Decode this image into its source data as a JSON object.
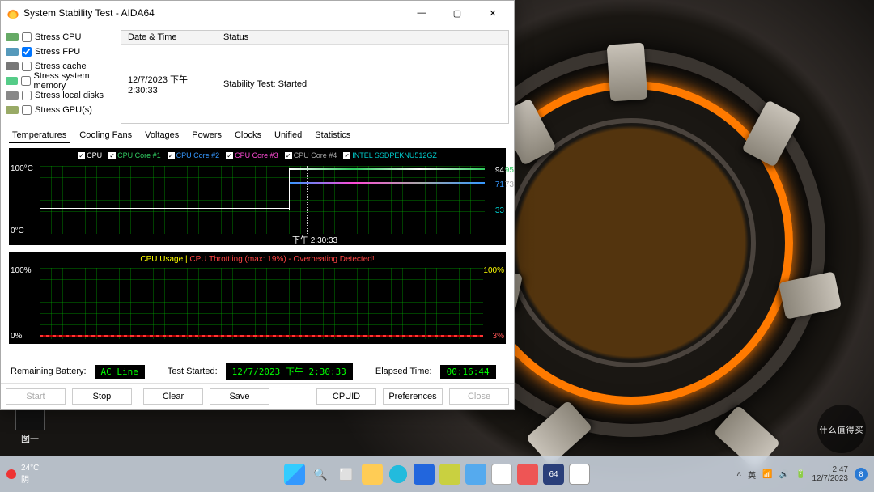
{
  "window": {
    "title": "System Stability Test - AIDA64",
    "buttons": {
      "min": "—",
      "max": "▢",
      "close": "✕"
    }
  },
  "stress": {
    "items": [
      {
        "label": "Stress CPU",
        "checked": false,
        "iconcls": "cpu"
      },
      {
        "label": "Stress FPU",
        "checked": true,
        "iconcls": "fpu"
      },
      {
        "label": "Stress cache",
        "checked": false,
        "iconcls": "cache"
      },
      {
        "label": "Stress system memory",
        "checked": false,
        "iconcls": "mem"
      },
      {
        "label": "Stress local disks",
        "checked": false,
        "iconcls": "disk"
      },
      {
        "label": "Stress GPU(s)",
        "checked": false,
        "iconcls": "gpu"
      }
    ]
  },
  "log": {
    "headers": {
      "c1": "Date & Time",
      "c2": "Status"
    },
    "row": {
      "c1": "12/7/2023 下午 2:30:33",
      "c2": "Stability Test: Started"
    }
  },
  "tabs": [
    "Temperatures",
    "Cooling Fans",
    "Voltages",
    "Powers",
    "Clocks",
    "Unified",
    "Statistics"
  ],
  "chart1": {
    "legend": [
      {
        "label": "CPU",
        "color": "#ffffff"
      },
      {
        "label": "CPU Core #1",
        "color": "#31cc62"
      },
      {
        "label": "CPU Core #2",
        "color": "#3598ff"
      },
      {
        "label": "CPU Core #3",
        "color": "#ff4bd6"
      },
      {
        "label": "CPU Core #4",
        "color": "#a7a7a7"
      },
      {
        "label": "INTEL SSDPEKNU512GZ",
        "color": "#00cccc"
      }
    ],
    "y_top": "100°C",
    "y_bot": "0°C",
    "r1": "94",
    "r1b": "95",
    "r2": "71",
    "r2b": "73",
    "r3": "33",
    "cursor_time": "下午 2:30:33"
  },
  "chart2": {
    "title_a": "CPU Usage",
    "title_b": "CPU Throttling (max: 19%) - Overheating Detected!",
    "y_top": "100%",
    "y_bot": "0%",
    "r_top": "100%",
    "r_bot": "3%"
  },
  "status": {
    "battery_label": "Remaining Battery:",
    "battery_val": "AC Line",
    "started_label": "Test Started:",
    "started_val": "12/7/2023 下午 2:30:33",
    "elapsed_label": "Elapsed Time:",
    "elapsed_val": "00:16:44"
  },
  "buttons": {
    "start": "Start",
    "stop": "Stop",
    "clear": "Clear",
    "save": "Save",
    "cpuid": "CPUID",
    "prefs": "Preferences",
    "close": "Close"
  },
  "desktop": {
    "icon_label": "图一"
  },
  "taskbar": {
    "weather_temp": "24°C",
    "weather_desc": "阴",
    "time": "2:47",
    "date": "12/7/2023",
    "lang": "英"
  },
  "watermark": "什么值得买",
  "chart_data": {
    "temperatures": {
      "type": "line",
      "series": [
        {
          "name": "CPU",
          "value_at_cursor": 94
        },
        {
          "name": "CPU Core #1",
          "value_at_cursor": 95
        },
        {
          "name": "CPU Core #2",
          "value_at_cursor": 71
        },
        {
          "name": "CPU Core #3",
          "value_at_cursor": 73
        },
        {
          "name": "CPU Core #4",
          "value_at_cursor": 73
        },
        {
          "name": "INTEL SSDPEKNU512GZ",
          "value_at_cursor": 33
        }
      ],
      "ylim": [
        0,
        100
      ],
      "yunit": "°C",
      "cursor_x": "下午 2:30:33"
    },
    "usage": {
      "type": "line",
      "series": [
        {
          "name": "CPU Usage",
          "approx": 100
        },
        {
          "name": "CPU Throttling",
          "max": 19,
          "approx": 3
        }
      ],
      "ylim": [
        0,
        100
      ],
      "yunit": "%",
      "warning": "Overheating Detected!"
    }
  }
}
